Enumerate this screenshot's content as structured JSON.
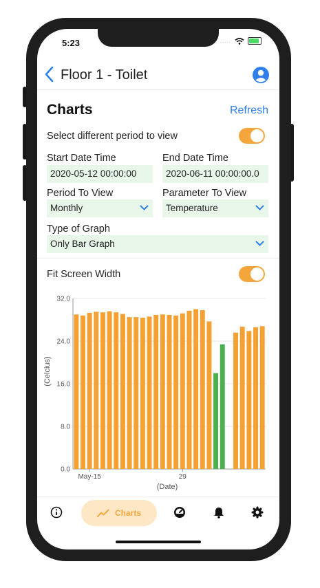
{
  "status_bar": {
    "time": "5:23",
    "signal": "....."
  },
  "nav": {
    "title": "Floor 1 - Toilet"
  },
  "charts_section": {
    "title": "Charts",
    "refresh_label": "Refresh"
  },
  "period_toggle": {
    "label": "Select different period to view",
    "on": true
  },
  "start_date": {
    "label": "Start Date Time",
    "value": "2020-05-12 00:00:00"
  },
  "end_date": {
    "label": "End Date Time",
    "value": "2020-06-11 00:00:00.0"
  },
  "period": {
    "label": "Period To View",
    "value": "Monthly"
  },
  "parameter": {
    "label": "Parameter To View",
    "value": "Temperature"
  },
  "graph_type": {
    "label": "Type of Graph",
    "value": "Only Bar Graph"
  },
  "fit_toggle": {
    "label": "Fit Screen Width",
    "on": true
  },
  "colors": {
    "accent": "#f4a63c",
    "bar_orange": "#f4a032",
    "bar_green": "#4caf50",
    "link": "#2f80ed",
    "field_bg": "#e8f5e9"
  },
  "chart_data": {
    "type": "bar",
    "xlabel": "(Date)",
    "ylabel": "(Celcius)",
    "ylim": [
      0,
      32
    ],
    "yticks": [
      "0.0",
      "8.0",
      "16.0",
      "24.0",
      "32.0"
    ],
    "x_tick_labels": [
      {
        "label": "May-15",
        "index": 2
      },
      {
        "label": "29",
        "index": 16
      }
    ],
    "grid": true,
    "values": [
      29.0,
      28.8,
      29.3,
      29.5,
      29.4,
      29.6,
      29.4,
      29.1,
      28.5,
      28.5,
      28.4,
      28.6,
      28.9,
      29.0,
      28.9,
      28.8,
      29.2,
      29.7,
      30.0,
      29.8,
      27.7,
      18.0,
      23.4,
      null,
      25.6,
      26.7,
      25.9,
      26.6,
      26.8
    ],
    "bar_colors": [
      "o",
      "o",
      "o",
      "o",
      "o",
      "o",
      "o",
      "o",
      "o",
      "o",
      "o",
      "o",
      "o",
      "o",
      "o",
      "o",
      "o",
      "o",
      "o",
      "o",
      "o",
      "g",
      "g",
      "o",
      "o",
      "o",
      "o",
      "o",
      "o"
    ]
  },
  "tabs": [
    {
      "name": "info",
      "icon": "info-icon"
    },
    {
      "name": "charts",
      "label": "Charts",
      "icon": "chart-line-icon",
      "active": true
    },
    {
      "name": "dashboard",
      "icon": "dashboard-gauge-icon"
    },
    {
      "name": "alerts",
      "icon": "bell-icon"
    },
    {
      "name": "settings",
      "icon": "gear-icon"
    }
  ]
}
